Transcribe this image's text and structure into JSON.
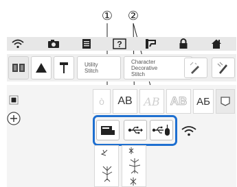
{
  "callouts": [
    "①",
    "②"
  ],
  "status_bar": {
    "icons": [
      "wifi-icon",
      "camera-icon",
      "document-icon",
      "help-icon",
      "thread-icon",
      "lock-icon",
      "home-icon"
    ]
  },
  "mode_bar": {
    "utility_stitch_label": "Utility\nStitch",
    "character_decorative_label": "Character\nDecorative\nStitch"
  },
  "font_cells": [
    {
      "text": "AB",
      "style": "plain"
    },
    {
      "text": "AB",
      "style": "script"
    },
    {
      "text": "AB",
      "style": "outline"
    },
    {
      "text": "AБ",
      "style": "cyrillic"
    }
  ],
  "source_buttons": [
    "machine-memory-icon",
    "usb-icon",
    "usb-mouse-icon",
    "wifi-icon"
  ],
  "colors": {
    "highlight": "#1e6fd0",
    "bar_bg": "#e7e7e7",
    "icon": "#222222"
  }
}
